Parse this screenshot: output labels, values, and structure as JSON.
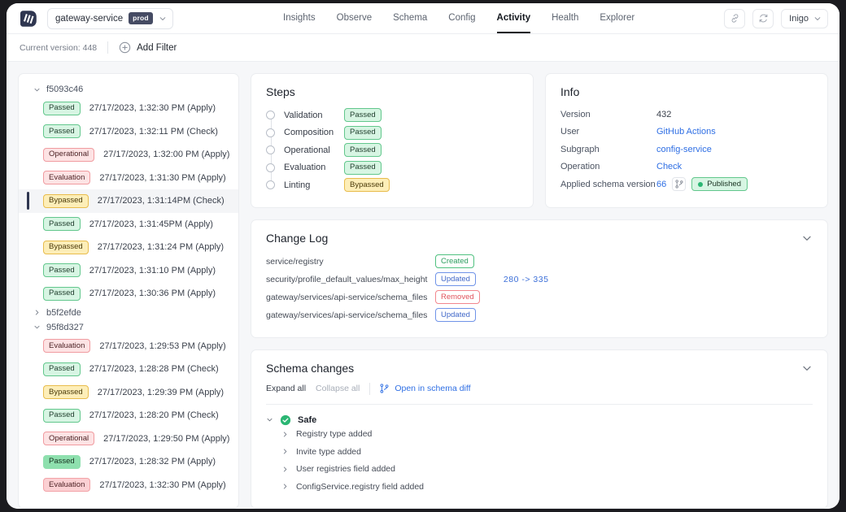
{
  "topbar": {
    "logo_icon": "inigo-logo",
    "service_name": "gateway-service",
    "env_badge": "prod",
    "service_chevron_icon": "chevron-down-icon",
    "nav": [
      {
        "label": "Insights",
        "active": false
      },
      {
        "label": "Observe",
        "active": false
      },
      {
        "label": "Schema",
        "active": false
      },
      {
        "label": "Config",
        "active": false
      },
      {
        "label": "Activity",
        "active": true
      },
      {
        "label": "Health",
        "active": false
      },
      {
        "label": "Explorer",
        "active": false
      }
    ],
    "link_icon": "link-icon",
    "refresh_icon": "refresh-icon",
    "user_name": "Inigo",
    "user_chevron_icon": "chevron-down-icon"
  },
  "filterbar": {
    "current_version": "Current version: 448",
    "add_filter": "Add Filter",
    "add_icon": "plus-circle-icon"
  },
  "sidebar": {
    "groups": [
      {
        "id": "f5093c46",
        "expanded": true,
        "caret_icon": "chevron-down-icon",
        "items": [
          {
            "status": "Passed",
            "style": "p-passed",
            "time": "27/17/2023, 1:32:30 PM (Apply)",
            "selected": false
          },
          {
            "status": "Passed",
            "style": "p-passed",
            "time": "27/17/2023, 1:32:11 PM (Check)",
            "selected": false
          },
          {
            "status": "Operational",
            "style": "p-red",
            "time": "27/17/2023, 1:32:00 PM (Apply)",
            "selected": false
          },
          {
            "status": "Evaluation",
            "style": "p-red",
            "time": "27/17/2023, 1:31:30 PM (Apply)",
            "selected": false
          },
          {
            "status": "Bypassed",
            "style": "p-bypassed",
            "time": "27/17/2023, 1:31:14PM (Check)",
            "selected": true
          },
          {
            "status": "Passed",
            "style": "p-passed",
            "time": "27/17/2023, 1:31:45PM (Apply)",
            "selected": false
          },
          {
            "status": "Bypassed",
            "style": "p-bypassed",
            "time": "27/17/2023, 1:31:24 PM (Apply)",
            "selected": false
          },
          {
            "status": "Passed",
            "style": "p-passed",
            "time": "27/17/2023, 1:31:10 PM (Apply)",
            "selected": false
          },
          {
            "status": "Passed",
            "style": "p-passed",
            "time": "27/17/2023, 1:30:36 PM (Apply)",
            "selected": false
          }
        ]
      },
      {
        "id": "b5f2efde",
        "expanded": false,
        "caret_icon": "chevron-right-icon",
        "items": []
      },
      {
        "id": "95f8d327",
        "expanded": true,
        "caret_icon": "chevron-down-icon",
        "items": [
          {
            "status": "Evaluation",
            "style": "p-red",
            "time": "27/17/2023, 1:29:53 PM (Apply)",
            "selected": false
          },
          {
            "status": "Passed",
            "style": "p-passed",
            "time": "27/17/2023, 1:28:28 PM (Check)",
            "selected": false
          },
          {
            "status": "Bypassed",
            "style": "p-bypassed",
            "time": "27/17/2023, 1:29:39 PM (Apply)",
            "selected": false
          },
          {
            "status": "Passed",
            "style": "p-passed",
            "time": "27/17/2023, 1:28:20 PM (Check)",
            "selected": false
          },
          {
            "status": "Operational",
            "style": "p-red",
            "time": "27/17/2023, 1:29:50 PM (Apply)",
            "selected": false
          },
          {
            "status": "Passed",
            "style": "p-passed-f",
            "time": "27/17/2023, 1:28:32 PM (Apply)",
            "selected": false
          },
          {
            "status": "Evaluation",
            "style": "p-red-f",
            "time": "27/17/2023, 1:32:30 PM (Apply)",
            "selected": false
          }
        ]
      }
    ]
  },
  "steps": {
    "title": "Steps",
    "rows": [
      {
        "label": "Validation",
        "status": "Passed",
        "style": "p-passed"
      },
      {
        "label": "Composition",
        "status": "Passed",
        "style": "p-passed"
      },
      {
        "label": "Operational",
        "status": "Passed",
        "style": "p-passed"
      },
      {
        "label": "Evaluation",
        "status": "Passed",
        "style": "p-passed"
      },
      {
        "label": "Linting",
        "status": "Bypassed",
        "style": "p-bypassed"
      }
    ]
  },
  "info": {
    "title": "Info",
    "version_label": "Version",
    "version_value": "432",
    "user_label": "User",
    "user_value": "GitHub Actions",
    "subgraph_label": "Subgraph",
    "subgraph_value": "config-service",
    "operation_label": "Operation",
    "operation_value": "Check",
    "applied_label": "Applied schema version",
    "applied_value": "66",
    "branch_icon": "branch-icon",
    "published_badge": "Published"
  },
  "changelog": {
    "title": "Change Log",
    "collapse_icon": "chevron-down-icon",
    "rows": [
      {
        "path": "service/registry",
        "badge": "Created",
        "badge_style": "b-created",
        "values": ""
      },
      {
        "path": "security/profile_default_values/max_height",
        "badge": "Updated",
        "badge_style": "b-updated",
        "values": "280  ->  335"
      },
      {
        "path": "gateway/services/api-service/schema_files",
        "badge": "Removed",
        "badge_style": "b-removed",
        "values": ""
      },
      {
        "path": "gateway/services/api-service/schema_files",
        "badge": "Updated",
        "badge_style": "b-updated",
        "values": ""
      }
    ]
  },
  "schema_changes": {
    "title": "Schema changes",
    "collapse_icon": "chevron-down-icon",
    "expand_all": "Expand all",
    "collapse_all": "Collapse all",
    "diff_link": "Open in schema diff",
    "diff_icon": "branch-icon",
    "group_caret_icon": "chevron-down-icon",
    "group_status_icon": "check-circle-icon",
    "group_label": "Safe",
    "items": [
      {
        "caret_icon": "chevron-right-icon",
        "label": "Registry type added"
      },
      {
        "caret_icon": "chevron-right-icon",
        "label": "Invite type added"
      },
      {
        "caret_icon": "chevron-right-icon",
        "label": "User registries field added"
      },
      {
        "caret_icon": "chevron-right-icon",
        "label": "ConfigService.registry field added"
      }
    ]
  },
  "colors": {
    "accent_link": "#2f6fe4",
    "brand_dark": "#2f3650",
    "green": "#2bb673",
    "red": "#e0535c",
    "yellow": "#e8bc4c",
    "page_bg": "#f6f7f9"
  }
}
